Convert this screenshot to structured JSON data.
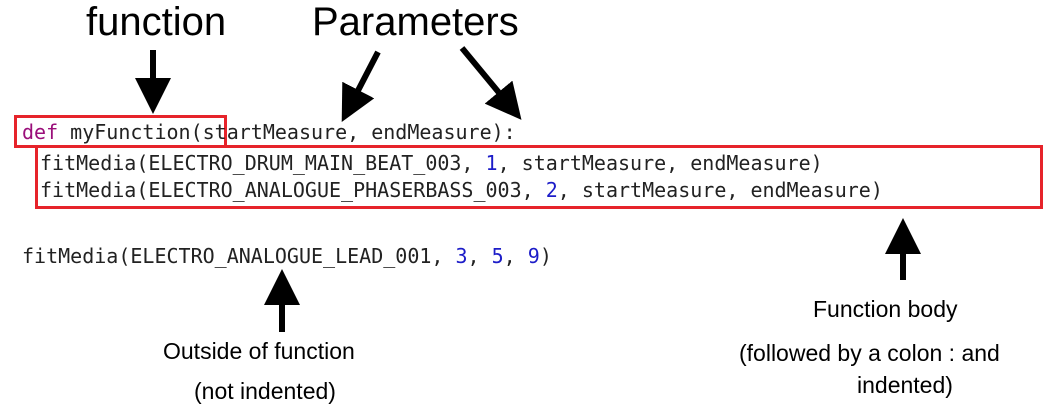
{
  "annotations": {
    "function": "function",
    "parameters": "Parameters",
    "body_line1": "Function body",
    "body_line2": "(followed by a colon : and",
    "body_line3": "indented)",
    "outside_line1": "Outside of function",
    "outside_line2": "(not indented)"
  },
  "code": {
    "def_keyword": "def",
    "func_name": "myFunction",
    "signature": "(startMeasure, endMeasure):",
    "line2_pre": "fitMedia(ELECTRO_DRUM_MAIN_BEAT_003, ",
    "line2_num": "1",
    "line2_post": ", startMeasure, endMeasure)",
    "line3_pre": "fitMedia(ELECTRO_ANALOGUE_PHASERBASS_003, ",
    "line3_num": "2",
    "line3_post": ", startMeasure, endMeasure)",
    "line4_pre": "fitMedia(ELECTRO_ANALOGUE_LEAD_001, ",
    "line4_n1": "3",
    "line4_sep1": ", ",
    "line4_n2": "5",
    "line4_sep2": ", ",
    "line4_n3": "9",
    "line4_post": ")"
  },
  "colors": {
    "keyword": "#9a0e7a",
    "number": "#1c1cc8",
    "highlight_box": "#e6232a",
    "text": "#222222"
  }
}
